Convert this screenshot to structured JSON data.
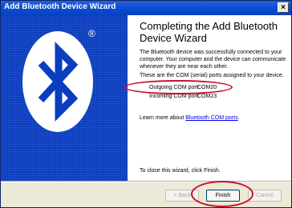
{
  "window": {
    "title": "Add Bluetooth Device Wizard",
    "close_glyph": "×"
  },
  "side": {
    "logo_icon": "bluetooth-icon",
    "reg_mark": "®",
    "bg_color": "#0a3dbf"
  },
  "main": {
    "heading": "Completing the Add Bluetooth Device Wizard",
    "paragraph1": "The Bluetooth device was successfully connected to your computer. Your computer and the device can communicate whenever they are near each other.",
    "paragraph2": "These are the COM (serial) ports assigned to your device.",
    "ports": [
      {
        "label": "Outgoing COM port:",
        "value": "COM20"
      },
      {
        "label": "Incoming COM port:",
        "value": "COM23"
      }
    ],
    "learn_prefix": "Learn more about ",
    "learn_link": "Bluetooth COM ports",
    "learn_suffix": ".",
    "close_note": "To close this wizard, click Finish."
  },
  "buttons": {
    "back": "< Back",
    "finish": "Finish",
    "cancel": "Cancel"
  },
  "annotation": {
    "color": "#c8102e"
  }
}
